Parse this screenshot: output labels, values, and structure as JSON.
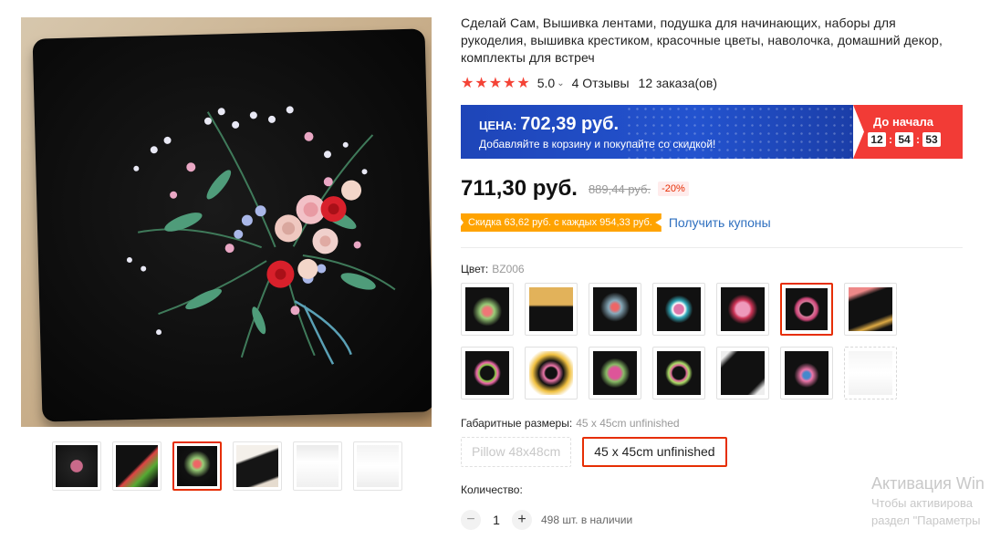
{
  "product": {
    "title": "Сделай Сам, Вышивка лентами, подушка для начинающих, наборы для рукоделия, вышивка крестиком, красочные цветы, наволочка, домашний декор, комплекты для встреч",
    "rating_stars": "★★★★★",
    "rating_value": "5.0",
    "reviews": "4 Отзывы",
    "orders": "12 заказа(ов)"
  },
  "promo": {
    "label": "ЦЕНА:",
    "price": "702,39 руб.",
    "subtitle": "Добавляйте в корзину и покупайте со скидкой!",
    "until": "До начала",
    "timer": [
      "12",
      "54",
      "53"
    ]
  },
  "price": {
    "current": "711,30 руб.",
    "old": "889,44 руб.",
    "discount": "-20%"
  },
  "coupon": {
    "tag": "Скидка 63,62 руб. с каждых 954,33 руб.",
    "link": "Получить купоны"
  },
  "color": {
    "label": "Цвет:",
    "selected": "BZ006"
  },
  "size": {
    "label": "Габаритные размеры:",
    "selected_value": "45 x 45cm unfinished",
    "options": [
      "Pillow 48x48cm",
      "45 x 45cm unfinished"
    ]
  },
  "quantity": {
    "label": "Количество:",
    "value": "1",
    "minus": "−",
    "plus": "+",
    "stock": "498 шт. в наличии"
  },
  "watermark": {
    "line1": "Активация Win",
    "line2": "Чтобы активирова",
    "line3": "раздел \"Параметры"
  },
  "icons": {
    "star": "star-icon",
    "chevron": "chevron-down-icon"
  },
  "colors": {
    "accent": "#e62e04",
    "promo_blue": "#2353cf",
    "promo_red": "#f23b36",
    "coupon_orange": "#ffa300",
    "link_blue": "#2e6fbf"
  }
}
